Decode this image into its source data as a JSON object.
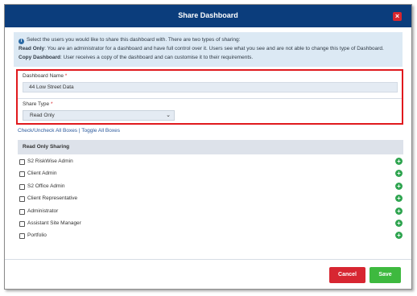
{
  "dialog": {
    "title": "Share Dashboard",
    "close_glyph": "×"
  },
  "info": {
    "icon": "i",
    "intro": "Select the users you would like to share this dashboard with. There are two types of sharing:",
    "read_only_label": "Read Only",
    "read_only_text": ": You are an administrator for a dashboard and have full control over it. Users see what you see and are not able to change this type of Dashboard.",
    "copy_label": "Copy Dashboard",
    "copy_text": ": User receives a copy of the dashboard and can customise it to their requirements."
  },
  "form": {
    "dashboard_name_label": "Dashboard Name",
    "dashboard_name_value": "44 Low Street Data",
    "share_type_label": "Share Type",
    "share_type_value": "Read Only",
    "required_mark": "*"
  },
  "links": {
    "check_uncheck": "Check/Uncheck All Boxes",
    "separator": "|",
    "toggle_all": "Toggle All Boxes"
  },
  "section": {
    "title": "Read Only Sharing"
  },
  "roles": [
    {
      "label": "S2 RiskWise Admin",
      "checked": false
    },
    {
      "label": "Client Admin",
      "checked": false
    },
    {
      "label": "S2 Office Admin",
      "checked": false
    },
    {
      "label": "Client Representative",
      "checked": false
    },
    {
      "label": "Administrator",
      "checked": false
    },
    {
      "label": "Assistant Site Manager",
      "checked": false
    },
    {
      "label": "Portfolio",
      "checked": false
    }
  ],
  "footer": {
    "cancel_label": "Cancel",
    "save_label": "Save"
  },
  "colors": {
    "titlebar": "#0b3d7c",
    "cancel": "#d72631",
    "save": "#3eb93f",
    "highlight": "#e0191d",
    "add": "#2ea44f"
  }
}
